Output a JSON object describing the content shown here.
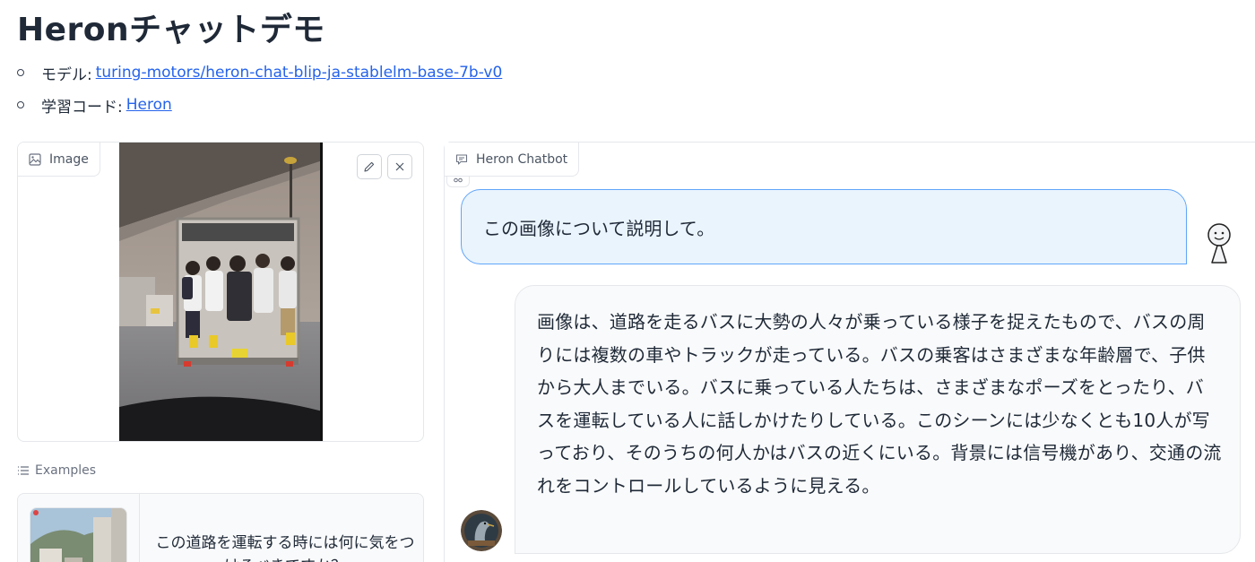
{
  "page": {
    "title": "Heronチャットデモ"
  },
  "meta": {
    "model_label": "モデル:",
    "model_link": "turing-motors/heron-chat-blip-ja-stablelm-base-7b-v0",
    "code_label": "学習コード:",
    "code_link": "Heron"
  },
  "image_panel": {
    "label": "Image",
    "icon": "image-icon",
    "edit_icon": "pencil-icon",
    "clear_icon": "close-icon"
  },
  "examples": {
    "label": "Examples",
    "icon": "list-icon",
    "items": [
      {
        "text": "この道路を運転する時には何に気をつけるべきですか？"
      }
    ]
  },
  "chat": {
    "label": "Heron Chatbot",
    "icon": "chat-icon",
    "messages": [
      {
        "role": "user",
        "text": "この画像について説明して。"
      },
      {
        "role": "bot",
        "text": "画像は、道路を走るバスに大勢の人々が乗っている様子を捉えたもので、バスの周りには複数の車やトラックが走っている。バスの乗客はさまざまな年齢層で、子供から大人までいる。バスに乗っている人たちは、さまざまなポーズをとったり、バスを運転している人に話しかけたりしている。このシーンには少なくとも10人が写っており、そのうちの何人かはバスの近くにいる。背景には信号機があり、交通の流れをコントロールしているように見える。"
      }
    ]
  },
  "colors": {
    "link": "#2563eb",
    "user_bubble_bg": "#eaf4fd",
    "user_bubble_border": "#60a5fa",
    "bot_bubble_bg": "#f9fafb"
  }
}
